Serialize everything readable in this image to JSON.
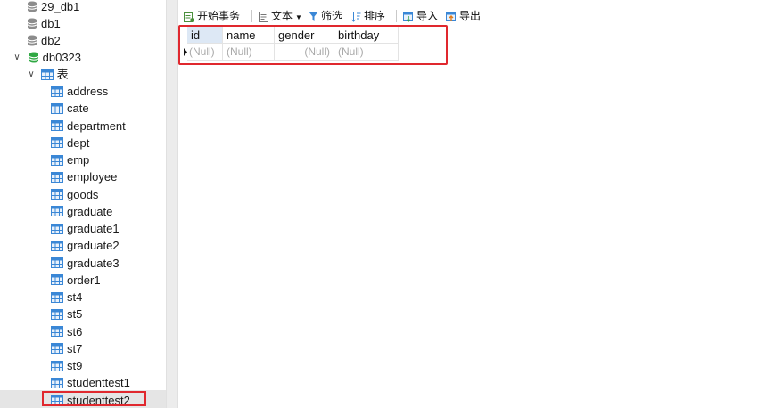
{
  "sidebar": {
    "databases_top": [
      {
        "label": "29_db1"
      },
      {
        "label": "db1"
      },
      {
        "label": "db2"
      }
    ],
    "open_db": {
      "label": "db0323",
      "color": "#2fa843"
    },
    "tables_group": {
      "label": "表"
    },
    "tables": [
      "address",
      "cate",
      "department",
      "dept",
      "emp",
      "employee",
      "goods",
      "graduate",
      "graduate1",
      "graduate2",
      "graduate3",
      "order1",
      "st4",
      "st5",
      "st6",
      "st7",
      "st9",
      "studenttest1",
      "studenttest2"
    ],
    "selected_table": "studenttest2"
  },
  "toolbar": {
    "begin_transaction": "开始事务",
    "text": "文本",
    "filter": "筛选",
    "sort": "排序",
    "import": "导入",
    "export": "导出"
  },
  "grid": {
    "columns": [
      "id",
      "name",
      "gender",
      "birthday"
    ],
    "row": [
      "(Null)",
      "(Null)",
      "(Null)",
      "(Null)"
    ]
  },
  "colors": {
    "highlight_border": "#e0282e",
    "table_icon": "#3a87d6",
    "db_icon": "#8c8c8c"
  }
}
